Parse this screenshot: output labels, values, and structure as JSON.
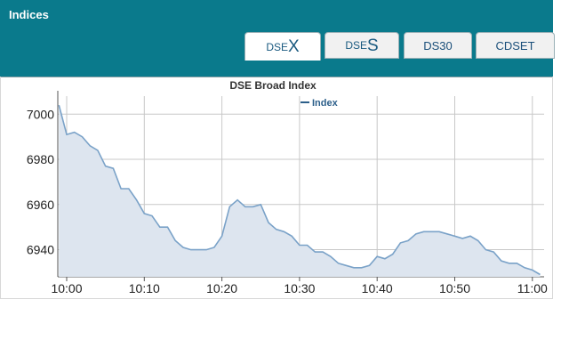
{
  "header": {
    "title": "Indices"
  },
  "tabs": [
    {
      "prefix": "DSE",
      "suffix": "X",
      "label": "",
      "active": true
    },
    {
      "prefix": "DSE",
      "suffix": "S",
      "label": "",
      "active": false
    },
    {
      "prefix": "",
      "suffix": "",
      "label": "DS30",
      "active": false
    },
    {
      "prefix": "",
      "suffix": "",
      "label": "CDSET",
      "active": false
    }
  ],
  "colors": {
    "header_bg": "#0a7a8c",
    "line": "#7aa2c8",
    "area": "#dde5ef",
    "tab_text": "#1a5a80"
  },
  "chart_data": {
    "type": "area",
    "title": "DSE Broad Index",
    "legend": "Index",
    "legend_position": "top",
    "xlabel": "",
    "ylabel": "",
    "ylim": [
      6928,
      7008
    ],
    "grid": true,
    "x_ticks": [
      "10:00",
      "10:10",
      "10:20",
      "10:30",
      "10:40",
      "10:50",
      "11:00"
    ],
    "y_ticks": [
      6940,
      6960,
      6980,
      7000
    ],
    "series": [
      {
        "x": [
          "09:59",
          "10:00",
          "10:01",
          "10:02",
          "10:03",
          "10:04",
          "10:05",
          "10:06",
          "10:07",
          "10:08",
          "10:09",
          "10:10",
          "10:11",
          "10:12",
          "10:13",
          "10:14",
          "10:15",
          "10:16",
          "10:17",
          "10:18",
          "10:19",
          "10:20",
          "10:21",
          "10:22",
          "10:23",
          "10:24",
          "10:25",
          "10:26",
          "10:27",
          "10:28",
          "10:29",
          "10:30",
          "10:31",
          "10:32",
          "10:33",
          "10:34",
          "10:35",
          "10:36",
          "10:37",
          "10:38",
          "10:39",
          "10:40",
          "10:41",
          "10:42",
          "10:43",
          "10:44",
          "10:45",
          "10:46",
          "10:47",
          "10:48",
          "10:49",
          "10:50",
          "10:51",
          "10:52",
          "10:53",
          "10:54",
          "10:55",
          "10:56",
          "10:57",
          "10:58",
          "10:59",
          "11:00",
          "11:01"
        ],
        "values": [
          7004,
          6991,
          6992,
          6990,
          6986,
          6984,
          6977,
          6976,
          6967,
          6967,
          6962,
          6956,
          6955,
          6950,
          6950,
          6944,
          6941,
          6940,
          6940,
          6940,
          6941,
          6946,
          6959,
          6962,
          6959,
          6959,
          6960,
          6952,
          6949,
          6948,
          6946,
          6942,
          6942,
          6939,
          6939,
          6937,
          6934,
          6933,
          6932,
          6932,
          6933,
          6937,
          6936,
          6938,
          6943,
          6944,
          6947,
          6948,
          6948,
          6948,
          6947,
          6946,
          6945,
          6946,
          6944,
          6940,
          6939,
          6935,
          6934,
          6934,
          6932,
          6931,
          6929
        ]
      }
    ]
  }
}
